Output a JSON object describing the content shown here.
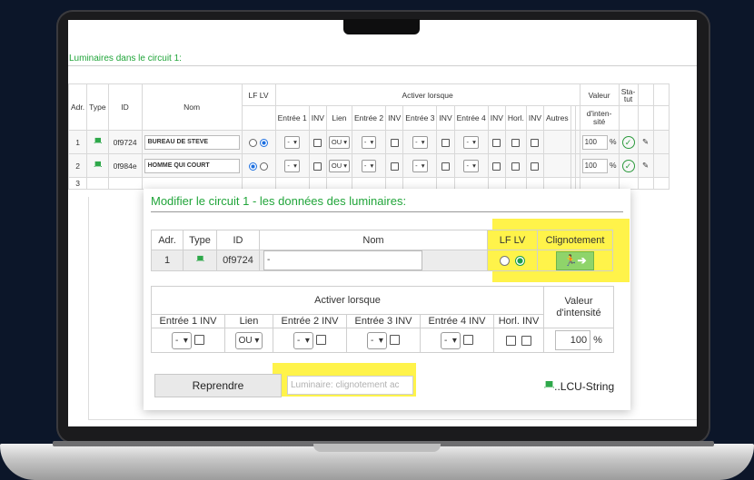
{
  "section_title": "Luminaires dans le circuit 1:",
  "table": {
    "headers": {
      "adr": "Adr.",
      "type": "Type",
      "id": "ID",
      "nom": "Nom",
      "lflv": "LF LV",
      "activer": "Activer lorsque",
      "valeur": "Valeur",
      "statut": "Sta-\ntut",
      "entree1": "Entrée 1",
      "inv1": "INV",
      "lien": "Lien",
      "entree2": "Entrée 2",
      "inv2": "INV",
      "entree3": "Entrée 3",
      "inv3": "INV",
      "entree4": "Entrée 4",
      "inv4": "INV",
      "horl": "Horl.",
      "inv5": "INV",
      "autres": "Autres",
      "intensite": "d'inten-\nsité"
    },
    "rows": [
      {
        "adr": "1",
        "id": "0f9724",
        "nom": "BUREAU DE STEVE",
        "lien": "OU",
        "dash": "-",
        "valeur": "100",
        "unit": "%",
        "lf": false,
        "lv": true
      },
      {
        "adr": "2",
        "id": "0f984e",
        "nom": "HOMME QUI COURT",
        "lien": "OU",
        "dash": "-",
        "valeur": "100",
        "unit": "%",
        "lf": true,
        "lv": false
      },
      {
        "adr": "3"
      }
    ]
  },
  "modal": {
    "title": "Modifier le circuit 1 - les données des luminaires:",
    "headers": {
      "adr": "Adr.",
      "type": "Type",
      "id": "ID",
      "nom": "Nom",
      "lflv": "LF LV",
      "clignotement": "Clignotement"
    },
    "row": {
      "adr": "1",
      "id": "0f9724",
      "nom": "-",
      "lf": false,
      "lv": true
    },
    "activer_label": "Activer lorsque",
    "valeur_label": "Valeur\nd'intensité",
    "sub": {
      "entree1": "Entrée 1 INV",
      "lien": "Lien",
      "entree2": "Entrée 2 INV",
      "entree3": "Entrée 3 INV",
      "entree4": "Entrée 4 INV",
      "horl": "Horl. INV"
    },
    "values": {
      "dash": "-",
      "lien": "OU",
      "valeur": "100",
      "unit": "%"
    },
    "reprendre": "Reprendre",
    "status_text": "Luminaire: clignotement ac",
    "lcu": "..LCU-String",
    "exit_icon": "emergency-exit-icon",
    "highlight_color": "#fff34a"
  }
}
